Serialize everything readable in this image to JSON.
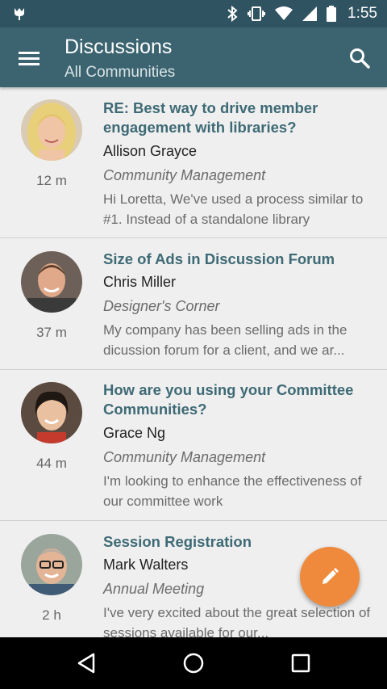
{
  "status_bar": {
    "time": "1:55",
    "icons": [
      "notification-icon",
      "bluetooth-icon",
      "vibrate-icon",
      "wifi-icon",
      "signal-icon",
      "battery-icon"
    ]
  },
  "app_bar": {
    "title": "Discussions",
    "subtitle": "All Communities",
    "menu_icon": "menu-icon",
    "search_icon": "search-icon"
  },
  "discussions": [
    {
      "subject": "RE: Best way to drive member engagement with libraries?",
      "author": "Allison Grayce",
      "community": "Community Management",
      "preview": "Hi Loretta, We've used a process similar to #1. Instead of a standalone library",
      "age": "12 m"
    },
    {
      "subject": "Size of Ads in Discussion Forum",
      "author": "Chris Miller",
      "community": "Designer's Corner",
      "preview": "My company has been selling ads in the dicussion forum for a client, and we ar...",
      "age": "37 m"
    },
    {
      "subject": "How are you using your Committee Communities?",
      "author": "Grace Ng",
      "community": "Community Management",
      "preview": "I'm looking to enhance the effectiveness of our committee work",
      "age": "44 m"
    },
    {
      "subject": "Session Registration",
      "author": "Mark Walters",
      "community": "Annual Meeting",
      "preview": "I've very excited about the great selection of sessions available for our...",
      "age": "2 h"
    }
  ],
  "fab": {
    "icon": "pencil-icon",
    "color": "#ef8a3d"
  },
  "nav_bar": {
    "icons": [
      "back-icon",
      "home-icon",
      "recents-icon"
    ]
  },
  "colors": {
    "status_bar": "#2f5360",
    "app_bar": "#3b6470",
    "subject_text": "#3e6a75",
    "background": "#efefef"
  }
}
